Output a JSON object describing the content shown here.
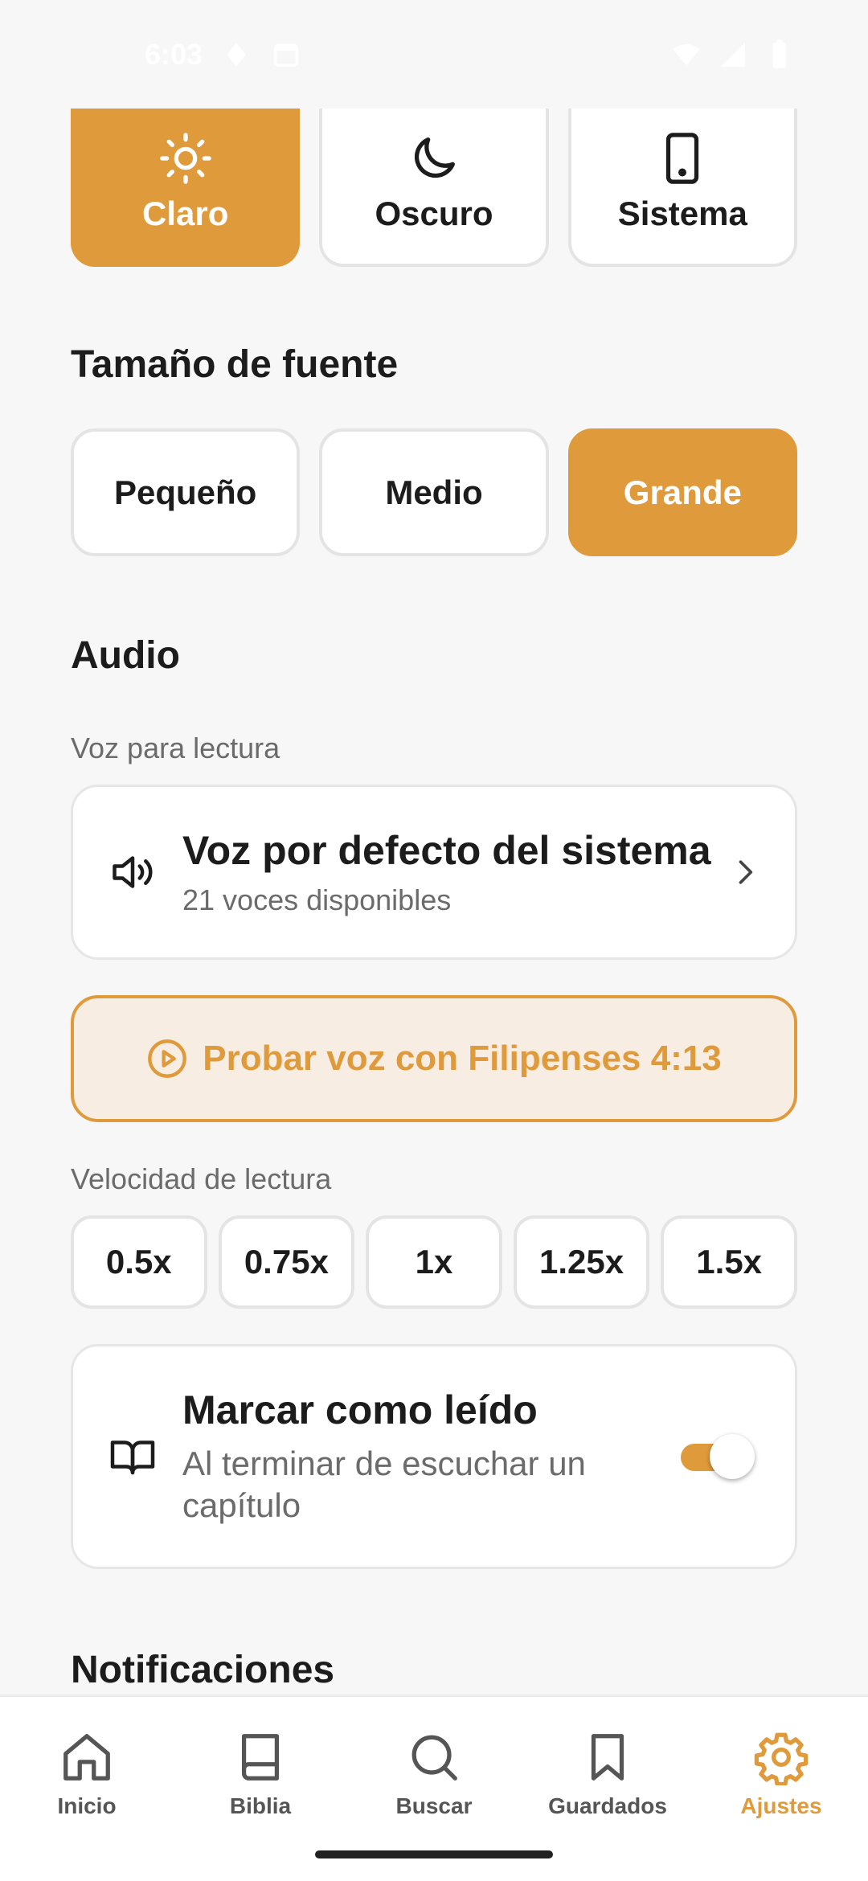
{
  "status_bar": {
    "time": "6:03"
  },
  "theme": {
    "options": [
      {
        "label": "Claro",
        "icon": "sun-icon"
      },
      {
        "label": "Oscuro",
        "icon": "moon-icon"
      },
      {
        "label": "Sistema",
        "icon": "phone-icon"
      }
    ],
    "selected": "Claro"
  },
  "font_size": {
    "title": "Tamaño de fuente",
    "options": [
      "Pequeño",
      "Medio",
      "Grande"
    ],
    "selected": "Grande"
  },
  "audio": {
    "title": "Audio",
    "voice_label": "Voz para lectura",
    "voice_title": "Voz por defecto del sistema",
    "voice_sub": "21 voces disponibles",
    "test_button": "Probar voz con Filipenses 4:13",
    "speed_label": "Velocidad de lectura",
    "speeds": [
      "0.5x",
      "0.75x",
      "1x",
      "1.25x",
      "1.5x"
    ],
    "mark_title": "Marcar como leído",
    "mark_sub": "Al terminar de escuchar un capítulo",
    "mark_enabled": true
  },
  "notifications": {
    "title": "Notificaciones"
  },
  "nav": {
    "items": [
      {
        "label": "Inicio",
        "icon": "home-icon"
      },
      {
        "label": "Biblia",
        "icon": "book-icon"
      },
      {
        "label": "Buscar",
        "icon": "search-icon"
      },
      {
        "label": "Guardados",
        "icon": "bookmark-icon"
      },
      {
        "label": "Ajustes",
        "icon": "gear-icon"
      }
    ],
    "active": "Ajustes"
  },
  "colors": {
    "accent": "#df9a3c",
    "accent_light": "#f8ede3",
    "background": "#f7f7f7"
  }
}
